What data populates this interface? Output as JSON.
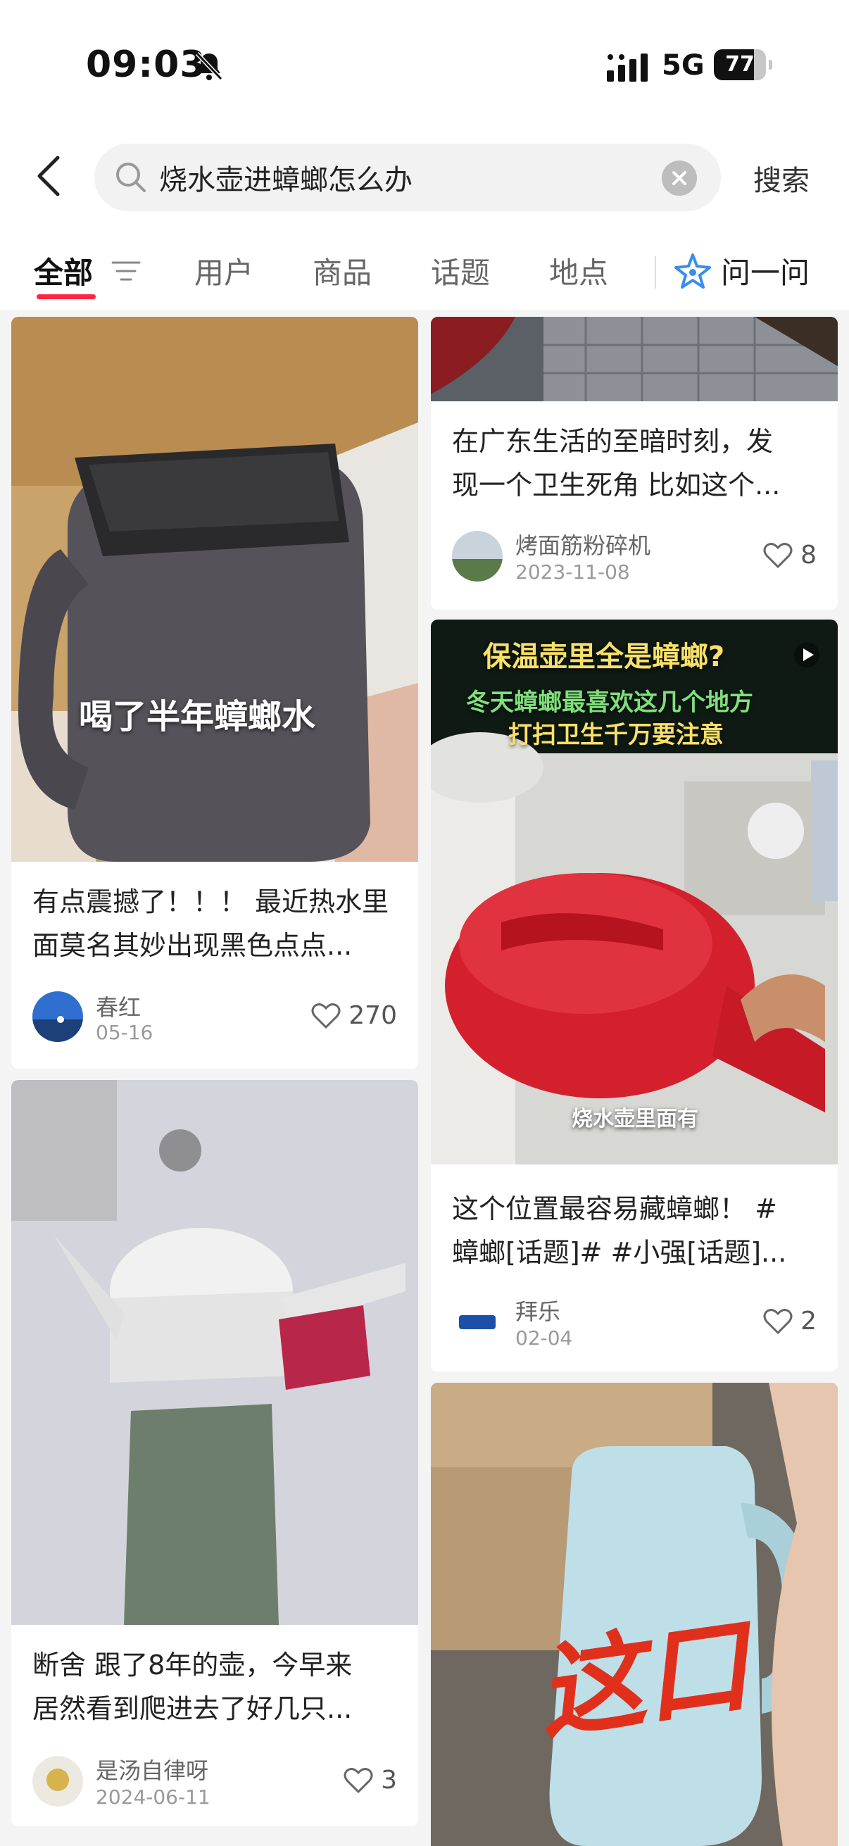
{
  "status_bar": {
    "time": "09:03",
    "network": "5G",
    "battery": "77",
    "battery_level": 0.77
  },
  "search": {
    "query": "烧水壶进蟑螂怎么办",
    "button_label": "搜索"
  },
  "tabs": [
    {
      "label": "全部",
      "active": true
    },
    {
      "label": "用户"
    },
    {
      "label": "商品"
    },
    {
      "label": "话题"
    },
    {
      "label": "地点"
    },
    {
      "label": "问一问"
    }
  ],
  "left_column": [
    {
      "image_text": "喝了半年蟑螂水",
      "title_lines": [
        "有点震撼了！！！  最近热水里",
        "面莫名其妙出现黑色点点..."
      ],
      "author": "春红",
      "date": "05-16",
      "likes": "270"
    },
    {
      "image_text": "",
      "title_lines": [
        "断舍 跟了8年的壶，今早来",
        "居然看到爬进去了好几只..."
      ],
      "author": "是汤自律呀",
      "date": "2024-06-11",
      "likes": "3"
    }
  ],
  "right_column": [
    {
      "title_lines": [
        "在广东生活的至暗时刻，发",
        "现一个卫生死角 比如这个..."
      ],
      "author": "烤面筋粉碎机",
      "date": "2023-11-08",
      "likes": "8"
    },
    {
      "image_headline": "保温壶里全是蟑螂?",
      "image_sub1": "冬天蟑螂最喜欢这几个地方",
      "image_sub2": "打扫卫生千万要注意",
      "image_caption": "烧水壶里面有",
      "title_lines": [
        "这个位置最容易藏蟑螂！ #",
        "蟑螂[话题]# #小强[话题]..."
      ],
      "author": "拜乐",
      "date": "02-04",
      "likes": "2"
    },
    {
      "image_handwriting": "这口"
    }
  ],
  "colors": {
    "accent": "#ff2442",
    "ask_icon": "#3b8cf0"
  },
  "icons": [
    "back-icon",
    "search-icon",
    "clear-icon",
    "filter-icon",
    "ask-ai-icon",
    "heart-icon",
    "mute-bell-icon",
    "signal-icon",
    "play-icon"
  ]
}
